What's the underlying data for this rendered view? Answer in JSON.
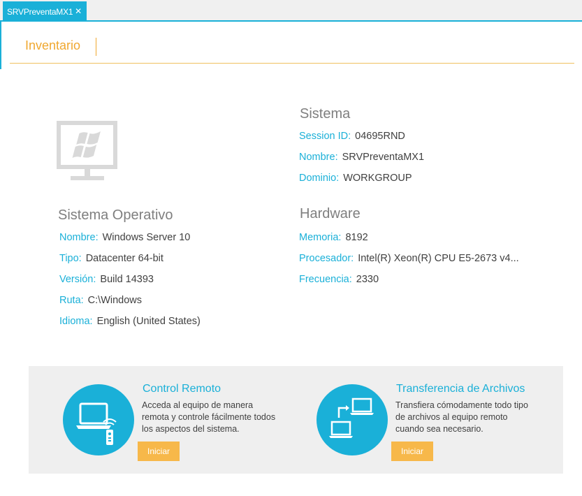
{
  "tab": {
    "title": "SRVPreventaMX1",
    "close": "✕"
  },
  "section": {
    "title": "Inventario"
  },
  "os": {
    "heading": "Sistema Operativo",
    "rows": [
      {
        "label": "Nombre:",
        "value": "Windows Server 10"
      },
      {
        "label": "Tipo:",
        "value": "Datacenter 64-bit"
      },
      {
        "label": "Versión:",
        "value": "Build 14393"
      },
      {
        "label": "Ruta:",
        "value": "C:\\Windows"
      },
      {
        "label": "Idioma:",
        "value": "English (United States)"
      }
    ]
  },
  "system": {
    "heading": "Sistema",
    "rows": [
      {
        "label": "Session ID:",
        "value": "04695RND"
      },
      {
        "label": "Nombre:",
        "value": "SRVPreventaMX1"
      },
      {
        "label": "Dominio:",
        "value": "WORKGROUP"
      }
    ]
  },
  "hardware": {
    "heading": "Hardware",
    "rows": [
      {
        "label": "Memoria:",
        "value": "8192"
      },
      {
        "label": "Procesador:",
        "value": "Intel(R) Xeon(R) CPU E5-2673 v4..."
      },
      {
        "label": "Frecuencia:",
        "value": "2330"
      }
    ]
  },
  "remote": {
    "title": "Control Remoto",
    "desc": "Acceda al equipo de manera remota y controle fácilmente todos los aspectos del sistema.",
    "button": "Iniciar",
    "icon": "remote-control-icon"
  },
  "transfer": {
    "title": "Transferencia de Archivos",
    "desc": "Transfiera cómodamente todo tipo de archivos al equipo remoto cuando sea necesario.",
    "button": "Iniciar",
    "icon": "file-transfer-icon"
  },
  "colors": {
    "accent": "#1ab0d8",
    "orange": "#f0a830",
    "button": "#f7b84a",
    "panel": "#efefef"
  }
}
